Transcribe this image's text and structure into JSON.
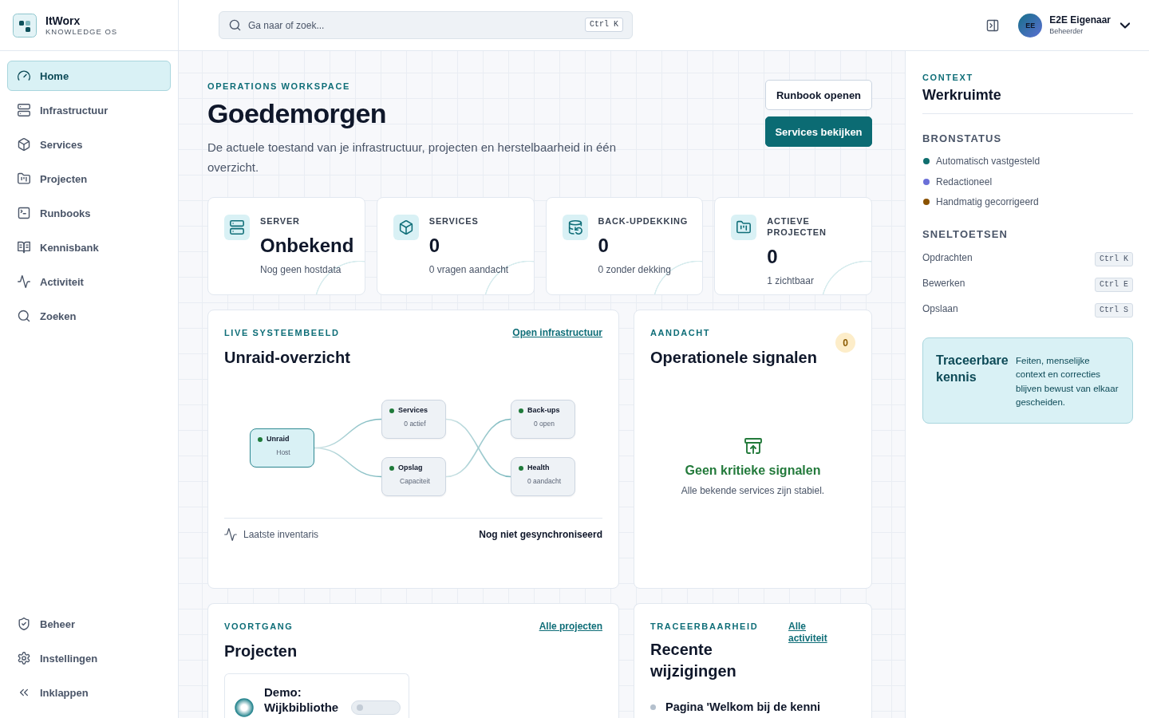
{
  "brand": {
    "name": "ItWorx",
    "tagline": "KNOWLEDGE OS"
  },
  "sidebar": {
    "items": [
      {
        "label": "Home",
        "selected": true
      },
      {
        "label": "Infrastructuur",
        "selected": false
      },
      {
        "label": "Services",
        "selected": false
      },
      {
        "label": "Projecten",
        "selected": false
      },
      {
        "label": "Runbooks",
        "selected": false
      },
      {
        "label": "Kennisbank",
        "selected": false
      },
      {
        "label": "Activiteit",
        "selected": false
      },
      {
        "label": "Zoeken",
        "selected": false
      }
    ],
    "footer_items": [
      {
        "label": "Beheer",
        "selected": false
      },
      {
        "label": "Instellingen",
        "selected": false
      },
      {
        "label": "Inklappen",
        "selected": false
      }
    ]
  },
  "topbar": {
    "search": {
      "placeholder": "Ga naar of zoek...",
      "shortcut": "Ctrl K"
    },
    "user": {
      "initials": "EE",
      "name": "E2E Eigenaar",
      "role": "Beheerder"
    }
  },
  "header": {
    "eyebrow": "OPERATIONS WORKSPACE",
    "title": "Goedemorgen",
    "description": "De actuele toestand van je infrastructuur, projecten en herstelbaarheid in één overzicht.",
    "buttons": [
      {
        "label": "Runbook openen",
        "kind": "secondary"
      },
      {
        "label": "Services bekijken",
        "kind": "primary"
      }
    ]
  },
  "stats": [
    {
      "label": "SERVER",
      "value": "Onbekend",
      "note": "Nog geen hostdata"
    },
    {
      "label": "SERVICES",
      "value": "0",
      "note": "0 vragen aandacht"
    },
    {
      "label": "BACK-UPDEKKING",
      "value": "0",
      "note": "0 zonder dekking"
    },
    {
      "label": "ACTIEVE PROJECTEN",
      "value": "0",
      "note": "1 zichtbaar"
    }
  ],
  "system_view": {
    "eyebrow": "LIVE SYSTEEMBEELD",
    "link": "Open infrastructuur",
    "title": "Unraid-overzicht",
    "diagram": {
      "nodes": [
        {
          "name": "Unraid",
          "detail": "Host",
          "kind": "host"
        },
        {
          "name": "Services",
          "detail": "0 actief",
          "kind": "service"
        },
        {
          "name": "Opslag",
          "detail": "Capaciteit",
          "kind": "service"
        },
        {
          "name": "Back-ups",
          "detail": "0 open",
          "kind": "service"
        },
        {
          "name": "Health",
          "detail": "0 aandacht",
          "kind": "service"
        }
      ]
    },
    "footer": {
      "label": "Laatste inventaris",
      "value": "Nog niet gesynchroniseerd"
    }
  },
  "signals": {
    "eyebrow": "AANDACHT",
    "count": "0",
    "title": "Operationele signalen",
    "empty": {
      "title": "Geen kritieke signalen",
      "text": "Alle bekende services zijn stabiel."
    }
  },
  "projects": {
    "eyebrow": "VOORTGANG",
    "link": "Alle projecten",
    "title": "Projecten",
    "items": [
      {
        "title": "Demo: Wijkbibliothe"
      }
    ]
  },
  "recent_changes": {
    "eyebrow": "TRACEERBAARHEID",
    "link": "Alle activiteit",
    "title": "Recente wijzigingen",
    "items": [
      {
        "title": "Pagina 'Welkom bij de kenni"
      }
    ]
  },
  "context": {
    "eyebrow": "CONTEXT",
    "title": "Werkruimte",
    "source_status": {
      "title": "BRONSTATUS",
      "items": [
        {
          "label": "Automatisch vastgesteld",
          "color": "#0f6e6e"
        },
        {
          "label": "Redactioneel",
          "color": "#6b70d8"
        },
        {
          "label": "Handmatig gecorrigeerd",
          "color": "#8a5200"
        }
      ]
    },
    "shortcuts": {
      "title": "SNELTOETSEN",
      "items": [
        {
          "label": "Opdrachten",
          "keys": "Ctrl K"
        },
        {
          "label": "Bewerken",
          "keys": "Ctrl E"
        },
        {
          "label": "Opslaan",
          "keys": "Ctrl S"
        }
      ]
    },
    "callout": {
      "title": "Traceerbare kennis",
      "text": "Feiten, menselijke context en correcties blijven bewust van elkaar gescheiden."
    }
  }
}
